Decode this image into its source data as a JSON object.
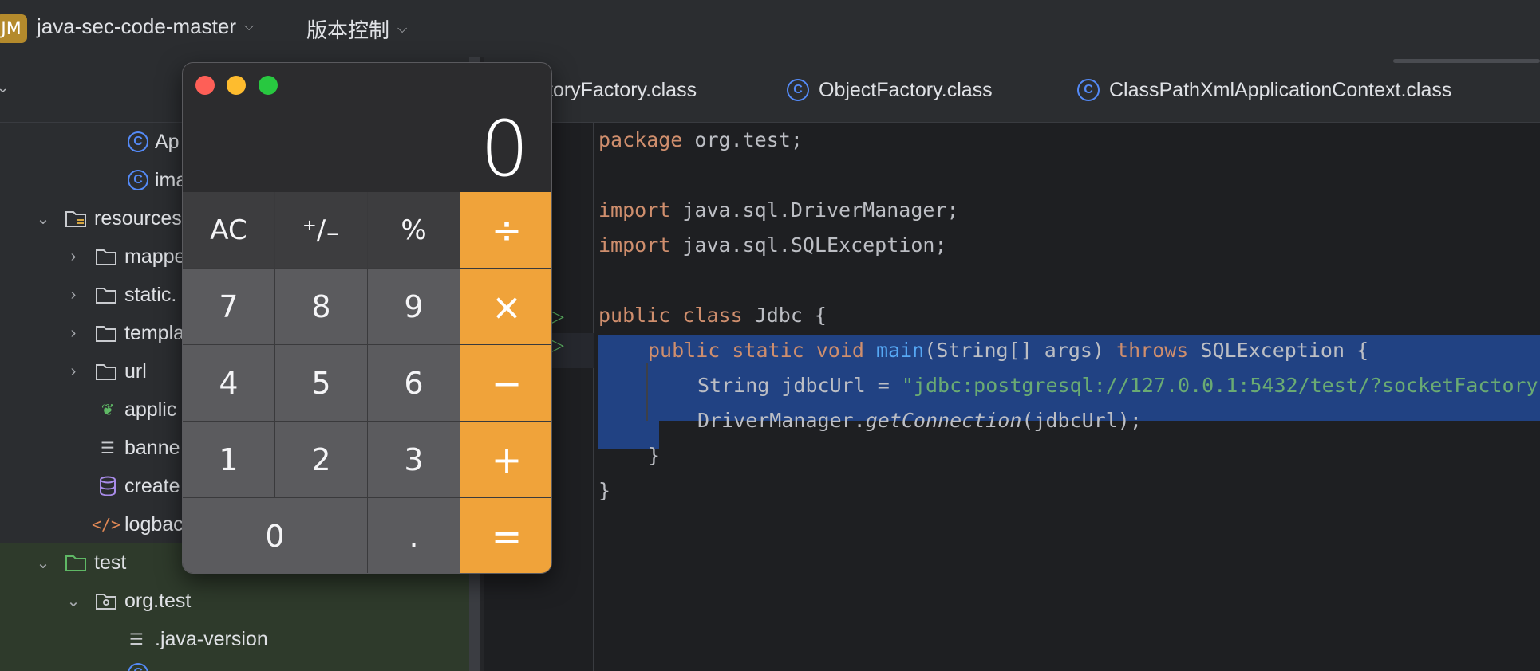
{
  "titlebar": {
    "project_badge": "JM",
    "project_name": "java-sec-code-master",
    "vcs_label": "版本控制"
  },
  "project_tree": {
    "rows": [
      {
        "label": "Ap",
        "icon": "spring-boot-app-icon"
      },
      {
        "label": "ima",
        "icon": "class-icon"
      },
      {
        "label": "resources",
        "icon": "resources-folder-icon"
      },
      {
        "label": "mappe",
        "icon": "folder-icon"
      },
      {
        "label": "static.",
        "icon": "folder-icon"
      },
      {
        "label": "templa",
        "icon": "folder-icon"
      },
      {
        "label": "url",
        "icon": "folder-icon"
      },
      {
        "label": "applic",
        "icon": "spring-config-icon"
      },
      {
        "label": "banne",
        "icon": "text-file-icon"
      },
      {
        "label": "create",
        "icon": "database-icon"
      },
      {
        "label": "logbac",
        "icon": "xml-icon"
      },
      {
        "label": "test",
        "icon": "test-folder-icon"
      },
      {
        "label": "org.test",
        "icon": "package-icon"
      },
      {
        "label": ".java-version",
        "icon": "text-file-icon"
      }
    ]
  },
  "tabs": [
    {
      "label": "toryFactory.class"
    },
    {
      "label": "ObjectFactory.class"
    },
    {
      "label": "ClassPathXmlApplicationContext.class"
    }
  ],
  "code": {
    "line1": {
      "kw": "package",
      "rest": " org.test;"
    },
    "line3": {
      "kw": "import",
      "rest": " java.sql.DriverManager;"
    },
    "line4": {
      "kw": "import",
      "rest": " java.sql.SQLException;"
    },
    "line6": {
      "kw": "public class",
      "rest": " Jdbc {"
    },
    "line7": {
      "kw1": "public static void",
      "fn": "main",
      "mid": "(String[] args) ",
      "kw2": "throws",
      "rest": " SQLException {"
    },
    "line8": {
      "pre": "String jdbcUrl = ",
      "str": "\"jdbc:postgresql://127.0.0.1:5432/test/?socketFactory"
    },
    "line9": {
      "pre": "DriverManager.",
      "method": "getConnection",
      "rest": "(jdbcUrl);"
    },
    "line10": "}",
    "line11": "}"
  },
  "calculator": {
    "display": "0",
    "keys": {
      "ac": "AC",
      "sign": "⁺∕₋",
      "percent": "%",
      "divide": "÷",
      "seven": "7",
      "eight": "8",
      "nine": "9",
      "multiply": "×",
      "four": "4",
      "five": "5",
      "six": "6",
      "minus": "−",
      "one": "1",
      "two": "2",
      "three": "3",
      "plus": "+",
      "zero": "0",
      "decimal": ".",
      "equals": "="
    }
  }
}
